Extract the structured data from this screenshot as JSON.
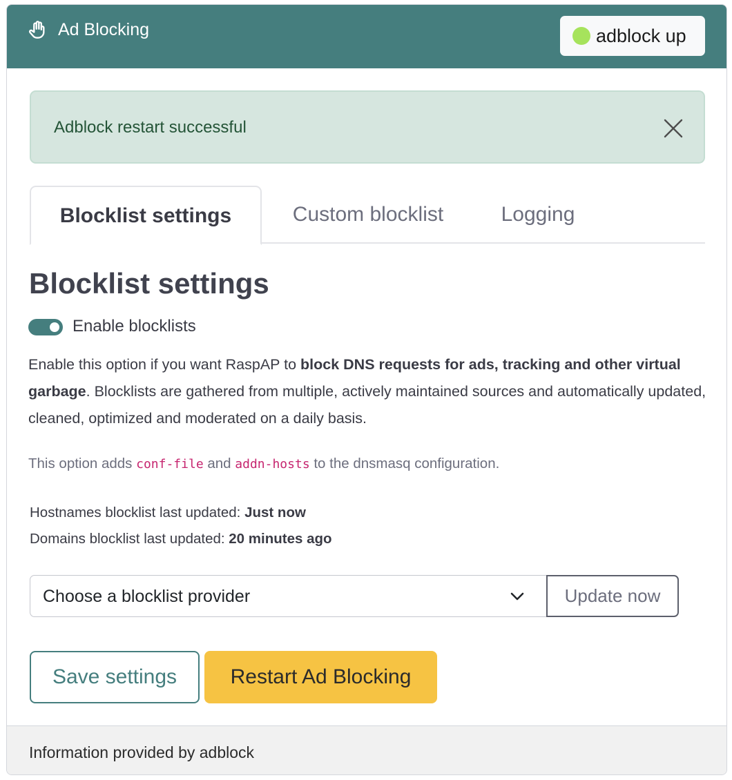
{
  "header": {
    "icon": "hand-paper-icon",
    "title": "Ad Blocking",
    "status_label": "adblock up",
    "status_color": "#a6e35c",
    "bg_color": "#457e7e"
  },
  "alert": {
    "message": "Adblock restart successful",
    "close_icon": "close-icon"
  },
  "tabs": [
    {
      "label": "Blocklist settings",
      "active": true
    },
    {
      "label": "Custom blocklist",
      "active": false
    },
    {
      "label": "Logging",
      "active": false
    }
  ],
  "section": {
    "title": "Blocklist settings",
    "toggle_label": "Enable blocklists",
    "toggle_on": true,
    "desc_part1": "Enable this option if you want RaspAP to ",
    "desc_bold": "block DNS requests for ads, tracking and other virtual garbage",
    "desc_part2": ". Blocklists are gathered from multiple, actively maintained sources and automatically updated, cleaned, optimized and moderated on a daily basis.",
    "note_part1": "This option adds ",
    "note_code1": "conf-file",
    "note_part2": " and ",
    "note_code2": "addn-hosts",
    "note_part3": " to the dnsmasq configuration."
  },
  "meta": {
    "hostnames_label": "Hostnames blocklist last updated: ",
    "hostnames_value": "Just now",
    "domains_label": "Domains blocklist last updated: ",
    "domains_value": "20 minutes ago"
  },
  "provider": {
    "select_value": "Choose a blocklist provider",
    "update_label": "Update now"
  },
  "actions": {
    "save_label": "Save settings",
    "restart_label": "Restart Ad Blocking"
  },
  "footer": {
    "text": "Information provided by adblock"
  }
}
